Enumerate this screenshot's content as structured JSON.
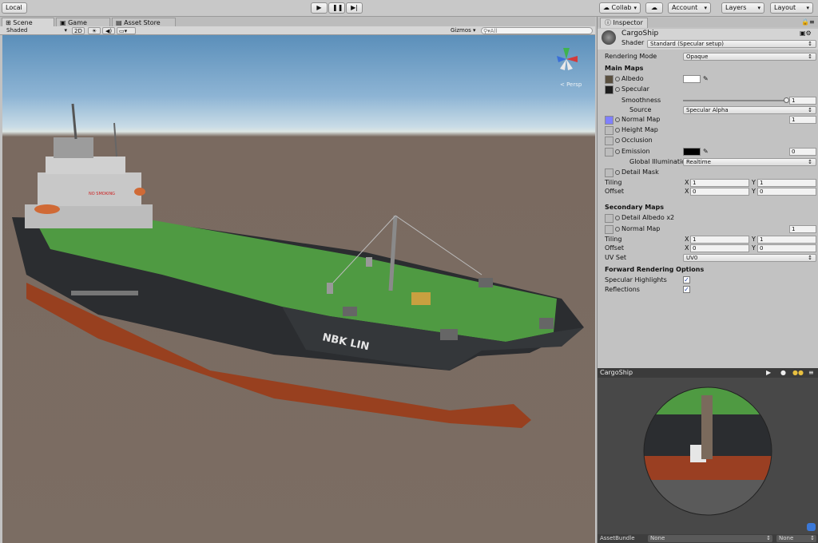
{
  "toolbar": {
    "local": "Local",
    "collab": "Collab",
    "account": "Account",
    "layers": "Layers",
    "layout": "Layout"
  },
  "scene_view": {
    "tabs": [
      "Scene",
      "Game",
      "Asset Store"
    ],
    "shading": "Shaded",
    "mode_2d": "2D",
    "gizmos": "Gizmos",
    "search_placeholder": "All",
    "persp": "< Persp",
    "ship_hull_text": "NBK LIN",
    "ship_sign": "NO SMOKING"
  },
  "inspector": {
    "tab": "Inspector",
    "material_name": "CargoShip",
    "shader_label": "Shader",
    "shader_value": "Standard (Specular setup)",
    "rendering_mode_label": "Rendering Mode",
    "rendering_mode_value": "Opaque",
    "main_maps": "Main Maps",
    "albedo": "Albedo",
    "specular": "Specular",
    "smoothness": "Smoothness",
    "smoothness_value": "1",
    "smoothness_level": 1.0,
    "source_label": "Source",
    "source_value": "Specular Alpha",
    "normal_map": "Normal Map",
    "normal_value": "1",
    "height_map": "Height Map",
    "occlusion": "Occlusion",
    "emission": "Emission",
    "emission_value": "0",
    "global_illum_label": "Global Illuminatio",
    "global_illum_value": "Realtime",
    "detail_mask": "Detail Mask",
    "tiling": "Tiling",
    "offset": "Offset",
    "x": "X",
    "y": "Y",
    "tiling_x": "1",
    "tiling_y": "1",
    "offset_x": "0",
    "offset_y": "0",
    "secondary_maps": "Secondary Maps",
    "detail_albedo": "Detail Albedo x2",
    "normal_map2": "Normal Map",
    "normal2_value": "1",
    "tiling2_x": "1",
    "tiling2_y": "1",
    "offset2_x": "0",
    "offset2_y": "0",
    "uv_set_label": "UV Set",
    "uv_set_value": "UV0",
    "forward_options": "Forward Rendering Options",
    "specular_highlights": "Specular Highlights",
    "reflections": "Reflections"
  },
  "preview": {
    "title": "CargoShip",
    "assetbundle": "AssetBundle",
    "none1": "None",
    "none2": "None"
  },
  "colors": {
    "normal_map_swatch": "#8080ff",
    "albedo_color": "#ffffff",
    "emission_color": "#000000",
    "deck": "#4f9a42",
    "hull": "#2b2d30",
    "hull_bottom": "#9a3f22"
  }
}
